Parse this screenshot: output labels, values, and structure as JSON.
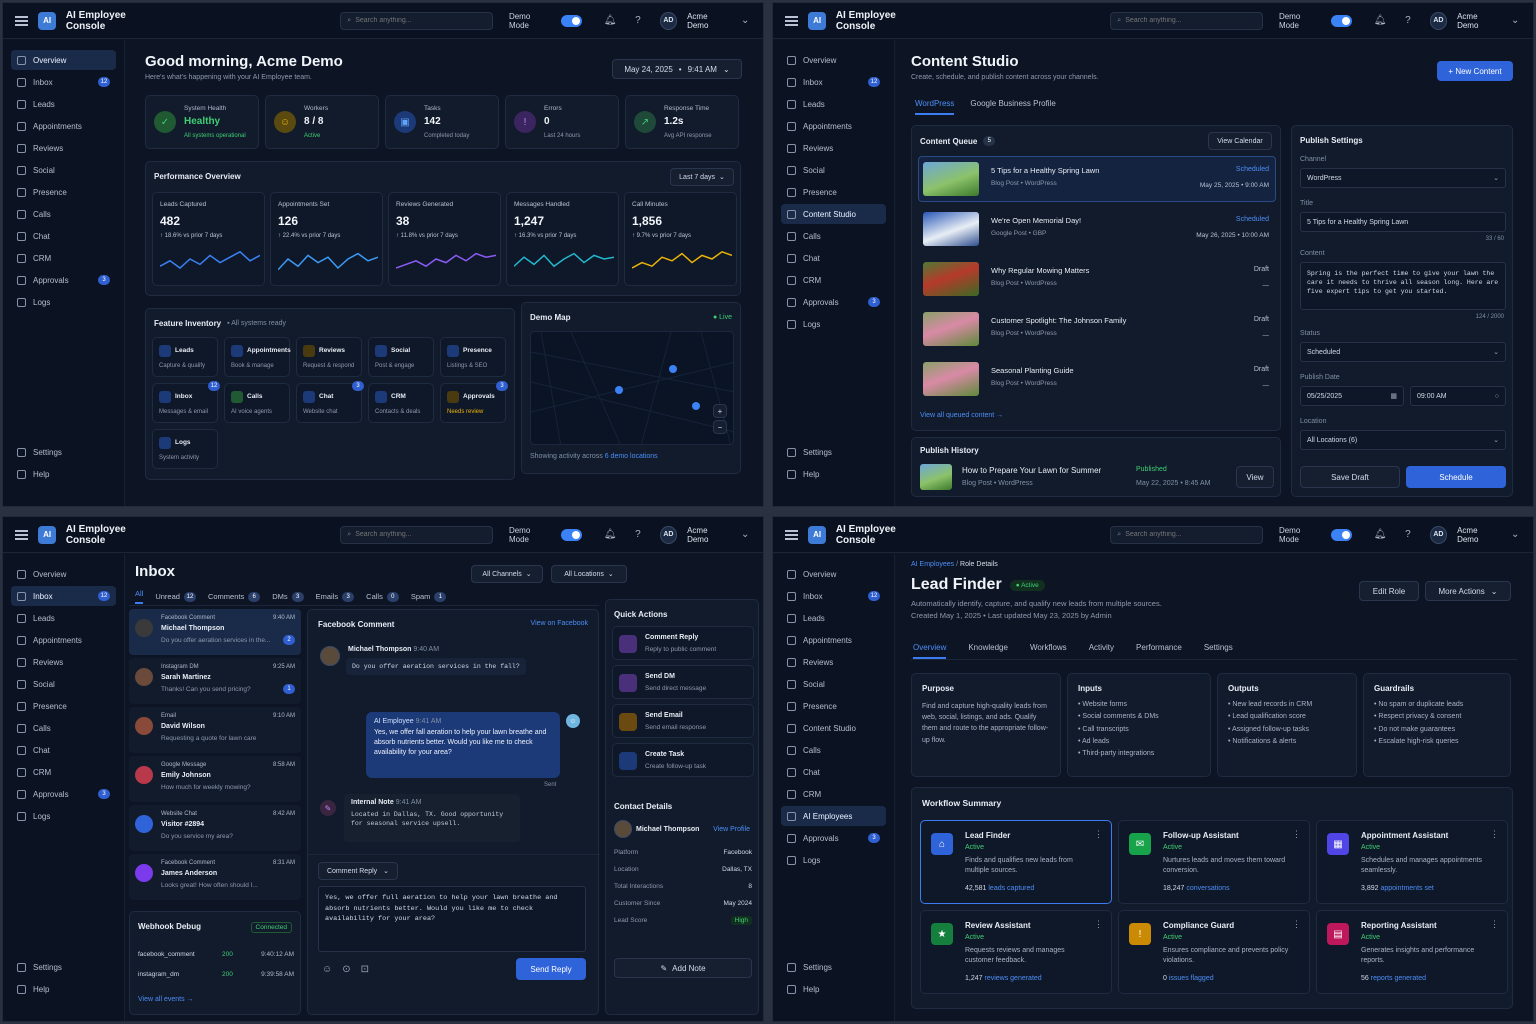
{
  "app": {
    "logo": "AI",
    "title": "AI Employee Console",
    "search_placeholder": "Search anything...",
    "demo_label": "Demo Mode",
    "avatar": "AD",
    "user": "Acme Demo"
  },
  "nav": {
    "overview": "Overview",
    "inbox": "Inbox",
    "inbox_badge": "12",
    "leads": "Leads",
    "appointments": "Appointments",
    "reviews": "Reviews",
    "social": "Social",
    "presence": "Presence",
    "content": "Content Studio",
    "calls": "Calls",
    "chat": "Chat",
    "crm": "CRM",
    "ai_employees": "AI Employees",
    "approvals": "Approvals",
    "approvals_badge": "3",
    "logs": "Logs",
    "settings": "Settings",
    "help": "Help"
  },
  "overview": {
    "greeting": "Good morning, Acme Demo",
    "subtitle": "Here's what's happening with your AI Employee team.",
    "date": "May 24, 2025",
    "time": "9:41 AM",
    "stats": [
      {
        "label": "System Health",
        "value": "Healthy",
        "note": "All systems operational"
      },
      {
        "label": "Workers",
        "value": "8 / 8",
        "note": "Active"
      },
      {
        "label": "Tasks",
        "value": "142",
        "note": "Completed today"
      },
      {
        "label": "Errors",
        "value": "0",
        "note": "Last 24 hours"
      },
      {
        "label": "Response Time",
        "value": "1.2s",
        "note": "Avg API response"
      }
    ],
    "perf_title": "Performance Overview",
    "range": "Last 7 days",
    "perf": [
      {
        "label": "Leads Captured",
        "value": "482",
        "delta": "18.6%",
        "note": "vs prior 7 days",
        "color": "#3b82f6"
      },
      {
        "label": "Appointments Set",
        "value": "126",
        "delta": "22.4%",
        "note": "vs prior 7 days",
        "color": "#3b9bf6"
      },
      {
        "label": "Reviews Generated",
        "value": "38",
        "delta": "11.8%",
        "note": "vs prior 7 days",
        "color": "#8b5cf6"
      },
      {
        "label": "Messages Handled",
        "value": "1,247",
        "delta": "16.3%",
        "note": "vs prior 7 days",
        "color": "#22b8cf"
      },
      {
        "label": "Call Minutes",
        "value": "1,856",
        "delta": "9.7%",
        "note": "vs prior 7 days",
        "color": "#eab308"
      }
    ],
    "inv_title": "Feature Inventory",
    "inv_status": "All systems ready",
    "features": [
      {
        "name": "Leads",
        "desc": "Capture & qualify",
        "badge": ""
      },
      {
        "name": "Appointments",
        "desc": "Book & manage",
        "badge": ""
      },
      {
        "name": "Reviews",
        "desc": "Request & respond",
        "badge": ""
      },
      {
        "name": "Social",
        "desc": "Post & engage",
        "badge": ""
      },
      {
        "name": "Presence",
        "desc": "Listings & SEO",
        "badge": ""
      },
      {
        "name": "Inbox",
        "desc": "Messages & email",
        "badge": "12"
      },
      {
        "name": "Calls",
        "desc": "AI voice agents",
        "badge": ""
      },
      {
        "name": "Chat",
        "desc": "Website chat",
        "badge": "3"
      },
      {
        "name": "CRM",
        "desc": "Contacts & deals",
        "badge": ""
      },
      {
        "name": "Approvals",
        "desc": "Needs review",
        "badge": "3"
      },
      {
        "name": "Logs",
        "desc": "System activity",
        "badge": ""
      }
    ],
    "map_title": "Demo Map",
    "map_live": "Live",
    "map_footer": "Showing activity across",
    "map_link": "6 demo locations"
  },
  "content": {
    "title": "Content Studio",
    "subtitle": "Create, schedule, and publish content across your channels.",
    "new_btn": "+ New Content",
    "tabs": [
      "WordPress",
      "Google Business Profile"
    ],
    "queue_title": "Content Queue",
    "queue_count": "5",
    "calendar_btn": "View Calendar",
    "queue": [
      {
        "title": "5 Tips for a Healthy Spring Lawn",
        "meta": "Blog Post • WordPress",
        "status": "Scheduled",
        "date": "May 25, 2025 • 9:00 AM"
      },
      {
        "title": "We're Open Memorial Day!",
        "meta": "Google Post • GBP",
        "status": "Scheduled",
        "date": "May 26, 2025 • 10:00 AM"
      },
      {
        "title": "Why Regular Mowing Matters",
        "meta": "Blog Post • WordPress",
        "status": "Draft",
        "date": "—"
      },
      {
        "title": "Customer Spotlight: The Johnson Family",
        "meta": "Blog Post • WordPress",
        "status": "Draft",
        "date": "—"
      },
      {
        "title": "Seasonal Planting Guide",
        "meta": "Blog Post • WordPress",
        "status": "Draft",
        "date": "—"
      }
    ],
    "view_all": "View all queued content →",
    "history_title": "Publish History",
    "history": {
      "title": "How to Prepare Your Lawn for Summer",
      "meta": "Blog Post • WordPress",
      "status": "Published",
      "date": "May 22, 2025 • 8:45 AM",
      "btn": "View"
    },
    "settings_title": "Publish Settings",
    "channel_label": "Channel",
    "channel": "WordPress",
    "title_label": "Title",
    "title_value": "5 Tips for a Healthy Spring Lawn",
    "title_count": "33 / 60",
    "content_label": "Content",
    "content_value": "Spring is the perfect time to give your lawn the care it needs to thrive all season long. Here are five expert tips to get you started.",
    "content_count": "124 / 2000",
    "status_label": "Status",
    "status": "Scheduled",
    "date_label": "Publish Date",
    "date": "05/25/2025",
    "time": "09:00 AM",
    "location_label": "Location",
    "location": "All Locations (6)",
    "save_btn": "Save Draft",
    "schedule_btn": "Schedule"
  },
  "inbox": {
    "title": "Inbox",
    "channels": "All Channels",
    "locations": "All Locations",
    "tabs": [
      {
        "label": "All",
        "count": ""
      },
      {
        "label": "Unread",
        "count": "12"
      },
      {
        "label": "Comments",
        "count": "6"
      },
      {
        "label": "DMs",
        "count": "3"
      },
      {
        "label": "Emails",
        "count": "3"
      },
      {
        "label": "Calls",
        "count": "0"
      },
      {
        "label": "Spam",
        "count": "1"
      }
    ],
    "messages": [
      {
        "source": "Facebook Comment",
        "name": "Michael Thompson",
        "time": "9:40 AM",
        "preview": "Do you offer aeration services in the...",
        "badge": "2"
      },
      {
        "source": "Instagram DM",
        "name": "Sarah Martinez",
        "time": "9:25 AM",
        "preview": "Thanks! Can you send pricing?",
        "badge": "1"
      },
      {
        "source": "Email",
        "name": "David Wilson",
        "time": "9:10 AM",
        "preview": "Requesting a quote for lawn care",
        "badge": ""
      },
      {
        "source": "Google Message",
        "name": "Emily Johnson",
        "time": "8:58 AM",
        "preview": "How much for weekly mowing?",
        "badge": ""
      },
      {
        "source": "Website Chat",
        "name": "Visitor #2894",
        "time": "8:42 AM",
        "preview": "Do you service my area?",
        "badge": ""
      },
      {
        "source": "Facebook Comment",
        "name": "James Anderson",
        "time": "8:31 AM",
        "preview": "Looks great! How often should I...",
        "badge": ""
      }
    ],
    "webhook_title": "Webhook Debug",
    "webhook_status": "Connected",
    "webhooks": [
      {
        "name": "facebook_comment",
        "code": "200",
        "time": "9:40:12 AM"
      },
      {
        "name": "instagram_dm",
        "code": "200",
        "time": "9:39:58 AM"
      }
    ],
    "view_events": "View all events →",
    "thread_title": "Facebook Comment",
    "view_fb": "View on Facebook",
    "thread_name": "Michael Thompson",
    "thread_time": "9:40 AM",
    "thread_msg": "Do you offer aeration services in the fall?",
    "ai_label": "AI Employee",
    "ai_time": "9:41 AM",
    "ai_msg": "Yes, we offer fall aeration to help your lawn breathe and absorb nutrients better. Would you like me to check availability for your area?",
    "sent": "Sent",
    "note_label": "Internal Note",
    "note_time": "9:41 AM",
    "note_msg": "Located in Dallas, TX. Good opportunity for seasonal service upsell.",
    "reply_type": "Comment Reply",
    "reply_text": "Yes, we offer full aeration to help your lawn breathe and absorb nutrients better. Would you like me to check availability for your area?",
    "send_btn": "Send Reply",
    "qa_title": "Quick Actions",
    "actions": [
      {
        "title": "Comment Reply",
        "desc": "Reply to public comment"
      },
      {
        "title": "Send DM",
        "desc": "Send direct message"
      },
      {
        "title": "Send Email",
        "desc": "Send email response"
      },
      {
        "title": "Create Task",
        "desc": "Create follow-up task"
      }
    ],
    "contact_title": "Contact Details",
    "contact_name": "Michael Thompson",
    "view_profile": "View Profile",
    "contact": [
      {
        "k": "Platform",
        "v": "Facebook"
      },
      {
        "k": "Location",
        "v": "Dallas, TX"
      },
      {
        "k": "Total Interactions",
        "v": "8"
      },
      {
        "k": "Customer Since",
        "v": "May 2024"
      },
      {
        "k": "Lead Score",
        "v": "High"
      }
    ],
    "add_note": "Add Note"
  },
  "role": {
    "crumb1": "AI Employees",
    "crumb2": "Role Details",
    "title": "Lead Finder",
    "active": "Active",
    "desc": "Automatically identify, capture, and qualify new leads from multiple sources.",
    "created": "Created May 1, 2025  •  Last updated May 23, 2025 by Admin",
    "edit_btn": "Edit Role",
    "more_btn": "More Actions",
    "tabs": [
      "Overview",
      "Knowledge",
      "Workflows",
      "Activity",
      "Performance",
      "Settings"
    ],
    "purpose_title": "Purpose",
    "purpose": "Find and capture high-quality leads from web, social, listings, and ads. Qualify them and route to the appropriate follow-up flow.",
    "inputs_title": "Inputs",
    "inputs": [
      "Website forms",
      "Social comments & DMs",
      "Call transcripts",
      "Ad leads",
      "Third-party integrations"
    ],
    "outputs_title": "Outputs",
    "outputs": [
      "New lead records in CRM",
      "Lead qualification score",
      "Assigned follow-up tasks",
      "Notifications & alerts"
    ],
    "guard_title": "Guardrails",
    "guardrails": [
      "No spam or duplicate leads",
      "Respect privacy & consent",
      "Do not make guarantees",
      "Escalate high-risk queries"
    ],
    "workflow_title": "Workflow Summary",
    "workers": [
      {
        "name": "Lead Finder",
        "status": "Active",
        "desc": "Finds and qualifies new leads from multiple sources.",
        "num": "42,581",
        "unit": "leads captured",
        "color": "#2f63d9"
      },
      {
        "name": "Follow-up Assistant",
        "status": "Active",
        "desc": "Nurtures leads and moves them toward conversion.",
        "num": "18,247",
        "unit": "conversations",
        "color": "#16a34a"
      },
      {
        "name": "Appointment Assistant",
        "status": "Active",
        "desc": "Schedules and manages appointments seamlessly.",
        "num": "3,892",
        "unit": "appointments set",
        "color": "#4f46e5"
      },
      {
        "name": "Review Assistant",
        "status": "Active",
        "desc": "Requests reviews and manages customer feedback.",
        "num": "1,247",
        "unit": "reviews generated",
        "color": "#15803d"
      },
      {
        "name": "Compliance Guard",
        "status": "Active",
        "desc": "Ensures compliance and prevents policy violations.",
        "num": "0",
        "unit": "issues flagged",
        "color": "#ca8a04"
      },
      {
        "name": "Reporting Assistant",
        "status": "Active",
        "desc": "Generates insights and performance reports.",
        "num": "56",
        "unit": "reports generated",
        "color": "#be185d"
      }
    ]
  }
}
